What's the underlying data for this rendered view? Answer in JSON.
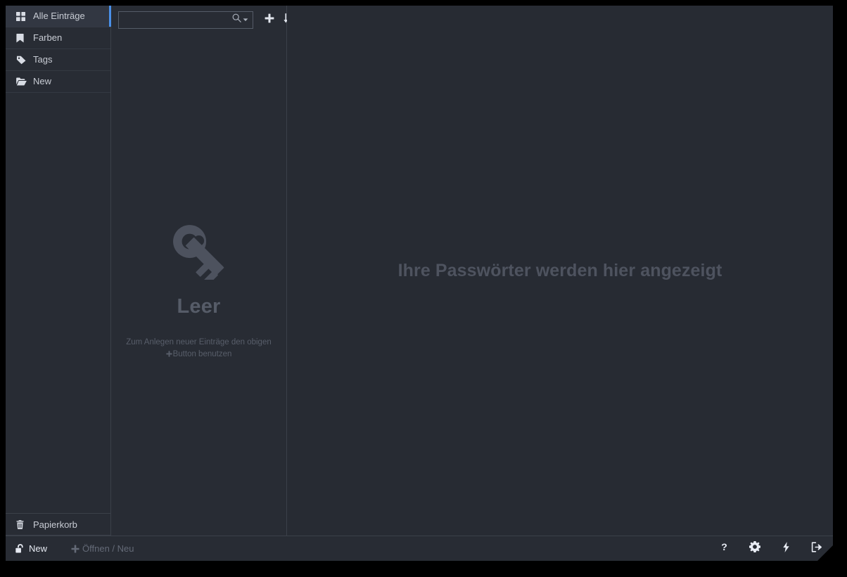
{
  "app": {
    "accent_color": "#4a90e8",
    "background_color": "#282c34",
    "main_panel_color": "#272b33",
    "frame_color": "#000000"
  },
  "sidebar": {
    "items": [
      {
        "label": "Alle Einträge",
        "icon": "grid-icon",
        "active": true
      },
      {
        "label": "Farben",
        "icon": "bookmark-icon",
        "active": false
      },
      {
        "label": "Tags",
        "icon": "tag-icon",
        "active": false
      },
      {
        "label": "New",
        "icon": "folder-open-icon",
        "active": false
      }
    ],
    "footer": {
      "trash_label": "Papierkorb",
      "trash_icon": "trash-icon"
    }
  },
  "entry_list": {
    "toolbar": {
      "search_placeholder": "",
      "search_value": "",
      "search_icon": "search-icon",
      "search_dropdown_icon": "caret-down-icon",
      "add_icon": "plus-icon",
      "sort_icon": "sort-alpha-down-icon"
    },
    "empty_state": {
      "icon": "key-icon",
      "title": "Leer",
      "description_line1": "Zum Anlegen neuer Einträge den obigen",
      "description_line2": "Button benutzen",
      "description_inline_icon": "plus-icon"
    }
  },
  "main": {
    "placeholder": "Ihre Passwörter werden hier angezeigt"
  },
  "status_bar": {
    "database": {
      "label": "New",
      "icon": "unlock-icon"
    },
    "open_new": {
      "label": "Öffnen / Neu",
      "icon": "plus-icon",
      "disabled": true
    },
    "actions": [
      {
        "name": "help-button",
        "icon": "question-mark-icon"
      },
      {
        "name": "settings-button",
        "icon": "gear-icon"
      },
      {
        "name": "autotype-button",
        "icon": "lightning-bolt-icon"
      },
      {
        "name": "exit-button",
        "icon": "sign-out-icon"
      }
    ]
  }
}
